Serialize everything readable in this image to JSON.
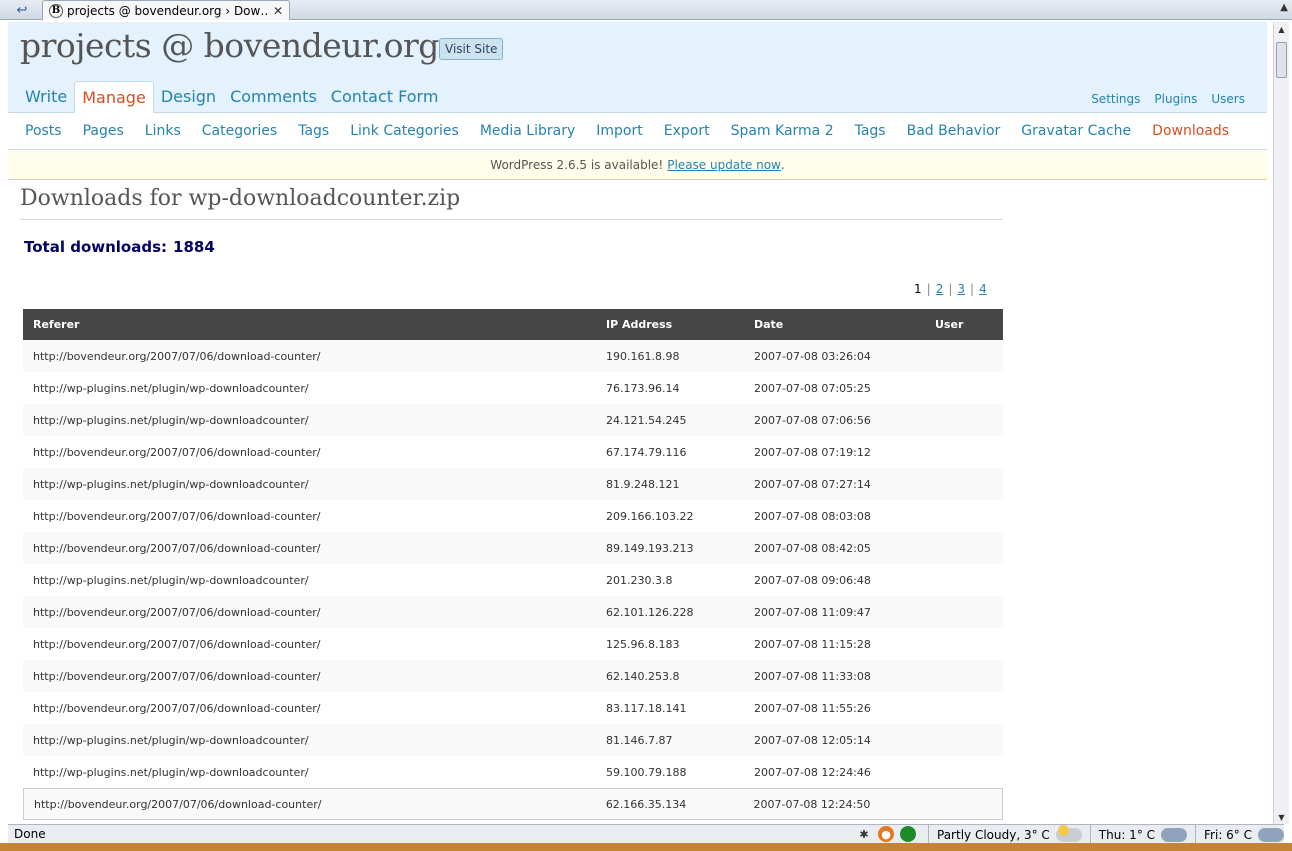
{
  "browser": {
    "tab_title": "projects @ bovendeur.org › Dow…",
    "tab_favicon": "B",
    "close_glyph": "✕",
    "status": "Done"
  },
  "header": {
    "site_title": "projects @ bovendeur.org",
    "visit_site": "Visit Site",
    "main_menu": [
      {
        "label": "Write"
      },
      {
        "label": "Manage",
        "current": true
      },
      {
        "label": "Design"
      },
      {
        "label": "Comments"
      },
      {
        "label": "Contact Form"
      }
    ],
    "user_menu": [
      "Settings",
      "Plugins",
      "Users"
    ]
  },
  "submenu": [
    {
      "label": "Posts"
    },
    {
      "label": "Pages"
    },
    {
      "label": "Links"
    },
    {
      "label": "Categories"
    },
    {
      "label": "Tags"
    },
    {
      "label": "Link Categories"
    },
    {
      "label": "Media Library"
    },
    {
      "label": "Import"
    },
    {
      "label": "Export"
    },
    {
      "label": "Spam Karma 2"
    },
    {
      "label": "Tags"
    },
    {
      "label": "Bad Behavior"
    },
    {
      "label": "Gravatar Cache"
    },
    {
      "label": "Downloads",
      "current": true
    }
  ],
  "update_nag": {
    "text": "WordPress 2.6.5 is available!",
    "link": "Please update now",
    "tail": "."
  },
  "main": {
    "title": "Downloads for wp-downloadcounter.zip",
    "total_label": "Total downloads:",
    "total_value": "1884",
    "pagination": [
      "1",
      "2",
      "3",
      "4"
    ],
    "pagination_current": "1",
    "columns": [
      "Referer",
      "IP Address",
      "Date",
      "User"
    ],
    "rows": [
      {
        "referer": "http://bovendeur.org/2007/07/06/download-counter/",
        "ip": "190.161.8.98",
        "date": "2007-07-08 03:26:04",
        "user": ""
      },
      {
        "referer": "http://wp-plugins.net/plugin/wp-downloadcounter/",
        "ip": "76.173.96.14",
        "date": "2007-07-08 07:05:25",
        "user": ""
      },
      {
        "referer": "http://wp-plugins.net/plugin/wp-downloadcounter/",
        "ip": "24.121.54.245",
        "date": "2007-07-08 07:06:56",
        "user": ""
      },
      {
        "referer": "http://bovendeur.org/2007/07/06/download-counter/",
        "ip": "67.174.79.116",
        "date": "2007-07-08 07:19:12",
        "user": ""
      },
      {
        "referer": "http://wp-plugins.net/plugin/wp-downloadcounter/",
        "ip": "81.9.248.121",
        "date": "2007-07-08 07:27:14",
        "user": ""
      },
      {
        "referer": "http://bovendeur.org/2007/07/06/download-counter/",
        "ip": "209.166.103.22",
        "date": "2007-07-08 08:03:08",
        "user": ""
      },
      {
        "referer": "http://bovendeur.org/2007/07/06/download-counter/",
        "ip": "89.149.193.213",
        "date": "2007-07-08 08:42:05",
        "user": ""
      },
      {
        "referer": "http://wp-plugins.net/plugin/wp-downloadcounter/",
        "ip": "201.230.3.8",
        "date": "2007-07-08 09:06:48",
        "user": ""
      },
      {
        "referer": "http://bovendeur.org/2007/07/06/download-counter/",
        "ip": "62.101.126.228",
        "date": "2007-07-08 11:09:47",
        "user": ""
      },
      {
        "referer": "http://bovendeur.org/2007/07/06/download-counter/",
        "ip": "125.96.8.183",
        "date": "2007-07-08 11:15:28",
        "user": ""
      },
      {
        "referer": "http://bovendeur.org/2007/07/06/download-counter/",
        "ip": "62.140.253.8",
        "date": "2007-07-08 11:33:08",
        "user": ""
      },
      {
        "referer": "http://bovendeur.org/2007/07/06/download-counter/",
        "ip": "83.117.18.141",
        "date": "2007-07-08 11:55:26",
        "user": ""
      },
      {
        "referer": "http://wp-plugins.net/plugin/wp-downloadcounter/",
        "ip": "81.146.7.87",
        "date": "2007-07-08 12:05:14",
        "user": ""
      },
      {
        "referer": "http://wp-plugins.net/plugin/wp-downloadcounter/",
        "ip": "59.100.79.188",
        "date": "2007-07-08 12:24:46",
        "user": ""
      },
      {
        "referer": "http://bovendeur.org/2007/07/06/download-counter/",
        "ip": "62.166.35.134",
        "date": "2007-07-08 12:24:50",
        "user": ""
      }
    ]
  },
  "statusbar": {
    "weather": [
      {
        "text": "Partly Cloudy, 3° C",
        "icon": "partly-cloudy-icon"
      },
      {
        "text": "Thu: 1° C",
        "icon": "rain-icon"
      },
      {
        "text": "Fri: 6° C",
        "icon": "rain-icon"
      }
    ]
  },
  "colors": {
    "link": "#2583ad",
    "current": "#d54e21",
    "header_bg": "#e4f2fd",
    "table_head": "#464646",
    "total": "#000066"
  }
}
